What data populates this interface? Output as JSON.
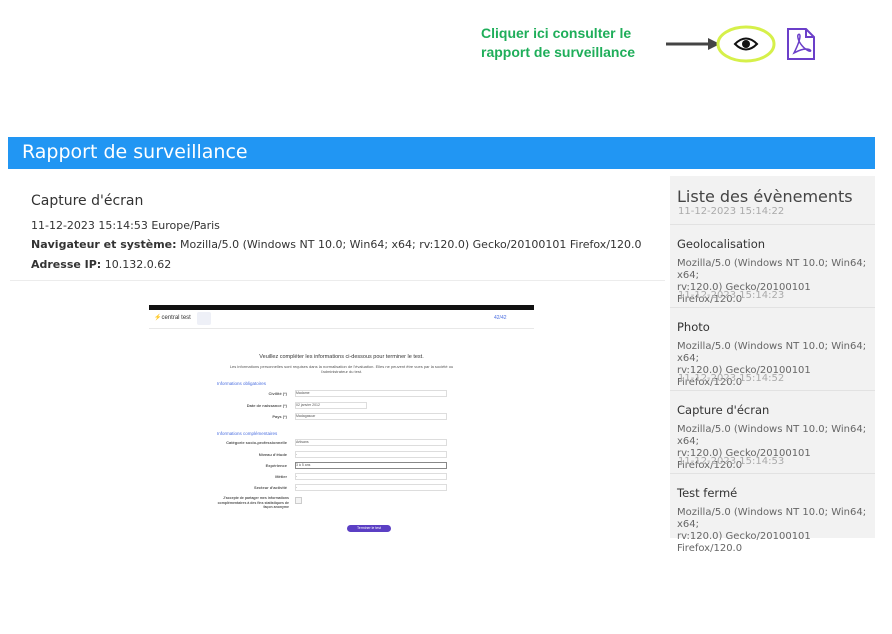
{
  "annotation": {
    "hint_line1": "Cliquer ici consulter le",
    "hint_line2": "rapport de surveillance",
    "eye_icon": "eye-icon",
    "pdf_icon": "pdf-icon",
    "accent_green": "#1fae5a",
    "highlight": "#d6f04a"
  },
  "panel": {
    "title": "Rapport de surveillance",
    "header_color": "#2196f3"
  },
  "capture": {
    "title": "Capture d'écran",
    "datetime": "11-12-2023 15:14:53 Europe/Paris",
    "browser_label": "Navigateur et système:",
    "browser_value": "Mozilla/5.0 (Windows NT 10.0; Win64; x64; rv:120.0) Gecko/20100101 Firefox/120.0",
    "ip_label": "Adresse IP:",
    "ip_value": "10.132.0.62"
  },
  "events": {
    "title": "Liste des évènements",
    "items": [
      {
        "date": "11-12-2023 15:14:22",
        "name": "Geolocalisation",
        "ua_line1": "Mozilla/5.0 (Windows NT 10.0; Win64; x64;",
        "ua_line2": "rv:120.0) Gecko/20100101 Firefox/120.0"
      },
      {
        "date": "11-12-2023 15:14:23",
        "name": "Photo",
        "ua_line1": "Mozilla/5.0 (Windows NT 10.0; Win64; x64;",
        "ua_line2": "rv:120.0) Gecko/20100101 Firefox/120.0"
      },
      {
        "date": "11-12-2023 15:14:52",
        "name": "Capture d'écran",
        "ua_line1": "Mozilla/5.0 (Windows NT 10.0; Win64; x64;",
        "ua_line2": "rv:120.0) Gecko/20100101 Firefox/120.0"
      },
      {
        "date": "11-12-2023 15:14:53",
        "name": "Test fermé",
        "ua_line1": "Mozilla/5.0 (Windows NT 10.0; Win64; x64;",
        "ua_line2": "rv:120.0) Gecko/20100101 Firefox/120.0"
      }
    ]
  },
  "screenshot": {
    "logo": "central test",
    "menu_icon": "menu-icon",
    "progress": "42/42",
    "heading": "Veuillez compléter les informations ci-dessous pour terminer le test.",
    "subheading": "Les informations personnelles sont requises dans la normalisation de l'évaluation. Elles ne peuvent être vues par la société ou l'administrateur du test.",
    "section_required": "Informations obligatoires",
    "section_optional": "Informations complémentaires",
    "fields": [
      {
        "label": "Civilité (*)",
        "value": "Madame"
      },
      {
        "label": "Date de naissance (*)",
        "value": "02   janvier   2012"
      },
      {
        "label": "Pays (*)",
        "value": "Madagascar"
      },
      {
        "label": "Catégorie socio-professionnelle",
        "value": "Artisans"
      },
      {
        "label": "Niveau d'étude",
        "value": "-"
      },
      {
        "label": "Expérience",
        "value": "3 à 5 ans"
      },
      {
        "label": "Métier",
        "value": "-"
      },
      {
        "label": "Secteur d'activité",
        "value": "-"
      }
    ],
    "consent": "J'accepte de partager mes informations complémentaires à des fins statistiques de façon anonyme",
    "submit": "Terminer le test"
  }
}
